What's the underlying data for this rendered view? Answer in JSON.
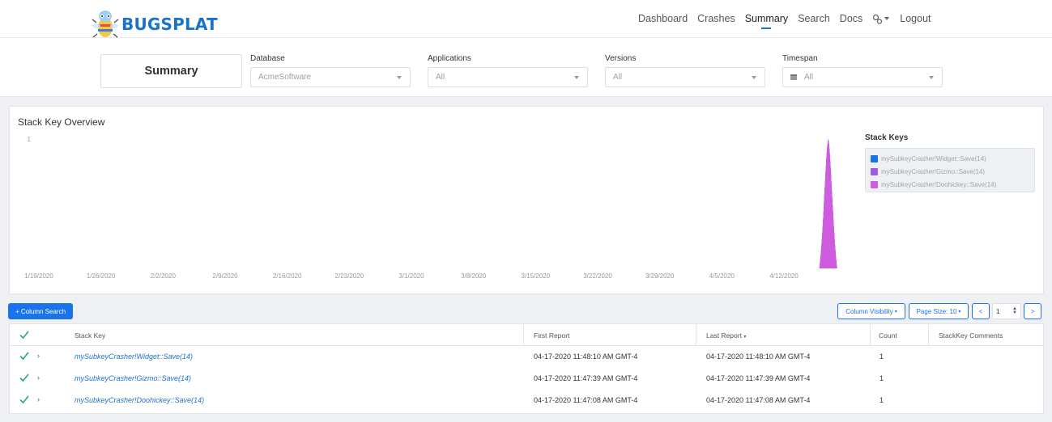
{
  "nav": {
    "brand": "BUGSPLAT",
    "links": [
      "Dashboard",
      "Crashes",
      "Summary",
      "Search",
      "Docs"
    ],
    "active": "Summary",
    "logout": "Logout"
  },
  "filters": {
    "page_title": "Summary",
    "database": {
      "label": "Database",
      "value": "AcmeSoftware"
    },
    "applications": {
      "label": "Applications",
      "value": "All"
    },
    "versions": {
      "label": "Versions",
      "value": "All"
    },
    "timespan": {
      "label": "Timespan",
      "value": "All"
    }
  },
  "chart": {
    "title": "Stack Key Overview",
    "legend_title": "Stack Keys"
  },
  "chart_data": {
    "type": "area",
    "title": "Stack Key Overview",
    "xlabel": "",
    "ylabel": "",
    "x_ticks": [
      "1/19/2020",
      "1/26/2020",
      "2/2/2020",
      "2/9/2020",
      "2/16/2020",
      "2/23/2020",
      "3/1/2020",
      "3/8/2020",
      "3/15/2020",
      "3/22/2020",
      "3/29/2020",
      "4/5/2020",
      "4/12/2020"
    ],
    "y_ticks": [
      "1"
    ],
    "ylim": [
      0,
      1
    ],
    "legend_placement": "right",
    "series": [
      {
        "name": "mySubkeyCrasher!Widget::Save(14)",
        "color": "#1a73e8",
        "points": [
          {
            "x": "4/17/2020",
            "y": 1
          }
        ]
      },
      {
        "name": "mySubkeyCrasher!Gizmo::Save(14)",
        "color": "#a05ce0",
        "points": [
          {
            "x": "4/17/2020",
            "y": 1
          }
        ]
      },
      {
        "name": "mySubkeyCrasher!Doohickey::Save(14)",
        "color": "#cf5cdf",
        "points": [
          {
            "x": "4/17/2020",
            "y": 1
          }
        ]
      }
    ]
  },
  "toolbar": {
    "column_search": "+ Column Search",
    "column_visibility": "Column Visibility",
    "page_size": "Page Size: 10",
    "prev": "<",
    "page": "1",
    "next": ">"
  },
  "table": {
    "headers": {
      "stack_key": "Stack Key",
      "first_report": "First Report",
      "last_report": "Last Report",
      "count": "Count",
      "comments": "StackKey Comments"
    },
    "rows": [
      {
        "stack_key": "mySubkeyCrasher!Widget::Save(14)",
        "first_report": "04-17-2020 11:48:10 AM GMT-4",
        "last_report": "04-17-2020 11:48:10 AM GMT-4",
        "count": "1",
        "comments": ""
      },
      {
        "stack_key": "mySubkeyCrasher!Gizmo::Save(14)",
        "first_report": "04-17-2020 11:47:39 AM GMT-4",
        "last_report": "04-17-2020 11:47:39 AM GMT-4",
        "count": "1",
        "comments": ""
      },
      {
        "stack_key": "mySubkeyCrasher!Doohickey::Save(14)",
        "first_report": "04-17-2020 11:47:08 AM GMT-4",
        "last_report": "04-17-2020 11:47:08 AM GMT-4",
        "count": "1",
        "comments": ""
      }
    ]
  },
  "colors": {
    "accent": "#1a73e8",
    "check": "#2aa58a"
  }
}
